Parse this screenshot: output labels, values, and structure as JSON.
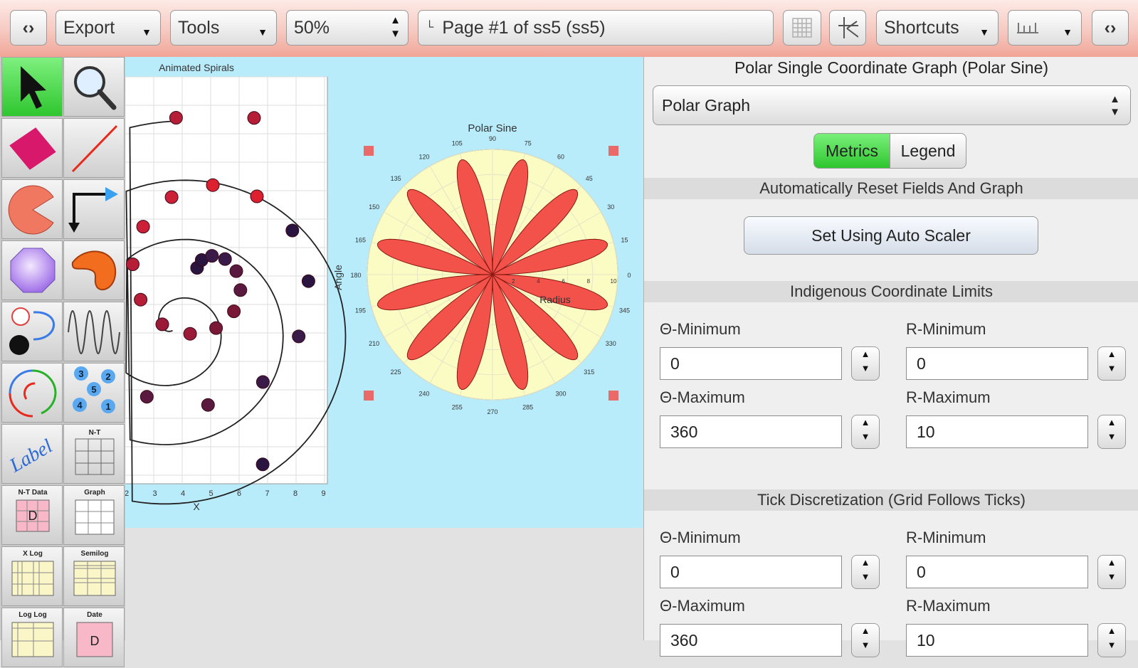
{
  "toolbar": {
    "export_label": "Export",
    "tools_label": "Tools",
    "zoom_value": "50%",
    "page_label": "Page #1 of ss5 (ss5)",
    "shortcuts_label": "Shortcuts"
  },
  "tools_palette": {
    "label_tool": "Label",
    "nt_label": "N-T",
    "nt_data_label": "N-T Data",
    "graph_label": "Graph",
    "xlog_label": "X Log",
    "semilog_label": "Semilog",
    "loglog_label": "Log Log",
    "date_label": "Date",
    "data_d": "D",
    "points_numbers": [
      "3",
      "2",
      "5",
      "4",
      "1"
    ]
  },
  "spiral_graph": {
    "title": "Animated Spirals",
    "xlabel": "X",
    "x_ticks": [
      "2",
      "3",
      "4",
      "5",
      "6",
      "7",
      "8",
      "9"
    ]
  },
  "polar_graph": {
    "title": "Polar Sine",
    "angle_label": "Angle",
    "radius_label": "Radius",
    "angle_ticks": [
      "90",
      "75",
      "60",
      "45",
      "30",
      "15",
      "0",
      "345",
      "330",
      "315",
      "300",
      "285",
      "270",
      "255",
      "240",
      "225",
      "210",
      "195",
      "180",
      "165",
      "150",
      "135",
      "120",
      "105"
    ],
    "radius_ticks": [
      "2",
      "4",
      "6",
      "8",
      "10"
    ],
    "colors": {
      "disc": "#fbfbc4",
      "petal": "#f2524a",
      "handle": "#ea6a6a"
    }
  },
  "chart_data": {
    "type": "polar",
    "title": "Polar Sine",
    "series": [
      {
        "function": "r = |10 sin(6θ)|",
        "petals": 12,
        "r_max": 10
      }
    ],
    "theta_range": [
      0,
      360
    ],
    "r_range": [
      0,
      10
    ]
  },
  "panel": {
    "title": "Polar Single Coordinate Graph (Polar Sine)",
    "graph_type": "Polar Graph",
    "tab_metrics": "Metrics",
    "tab_legend": "Legend",
    "section_auto": "Automatically Reset Fields And Graph",
    "auto_button": "Set Using Auto Scaler",
    "section_limits": "Indigenous Coordinate Limits",
    "section_ticks": "Tick Discretization (Grid Follows Ticks)",
    "limits": {
      "theta_min_label": "Θ-Minimum",
      "theta_min": "0",
      "r_min_label": "R-Minimum",
      "r_min": "0",
      "theta_max_label": "Θ-Maximum",
      "theta_max": "360",
      "r_max_label": "R-Maximum",
      "r_max": "10"
    },
    "ticks": {
      "theta_min_label": "Θ-Minimum",
      "theta_min": "0",
      "r_min_label": "R-Minimum",
      "r_min": "0",
      "theta_max_label": "Θ-Maximum",
      "theta_max": "360",
      "r_max_label": "R-Maximum",
      "r_max": "10"
    }
  }
}
